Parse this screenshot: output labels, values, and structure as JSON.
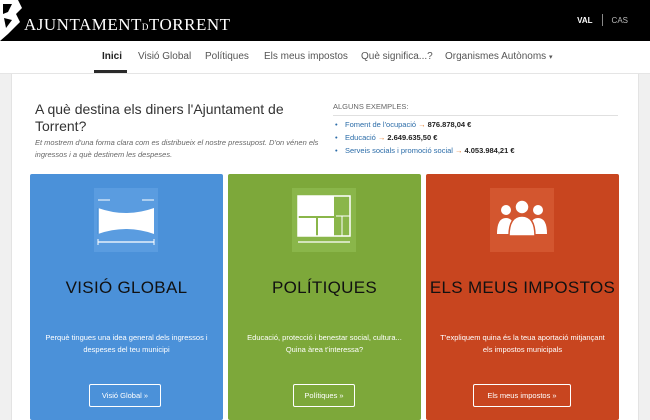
{
  "header": {
    "logo_text": "AJUNTAMENT",
    "logo_small": "D",
    "logo_text2": "TORRENT",
    "lang_active": "VAL",
    "lang_other": "CAS"
  },
  "nav": {
    "items": [
      "Inici",
      "Visió Global",
      "Polítiques",
      "Els meus impostos",
      "Què significa...?",
      "Organismes Autònoms"
    ],
    "caret": "▾"
  },
  "intro": {
    "title": "A què destina els diners l'Ajuntament de Torrent?",
    "subtitle": "Et mostrem d'una forma clara com es distribueix el nostre pressupost. D'on vénen els ingressos i a què destinem les despeses.",
    "examples_title": "ALGUNS EXEMPLES:",
    "examples": [
      {
        "label": "Foment de l'ocupació",
        "arrow": "→",
        "amount": "876.878,04 €"
      },
      {
        "label": "Educació",
        "arrow": "→",
        "amount": "2.649.635,50 €"
      },
      {
        "label": "Serveis socials i promoció social",
        "arrow": "→",
        "amount": "4.053.984,21 €"
      }
    ]
  },
  "cards": [
    {
      "title": "VISIÓ GLOBAL",
      "desc": "Perquè tingues una idea general dels ingressos i despeses del teu municipi",
      "button": "Visió Global »",
      "color": "#4b91d9",
      "icon": "flow-chart-icon"
    },
    {
      "title": "POLÍTIQUES",
      "desc": "Educació, protecció i benestar social, cultura... Quina àrea t'interessa?",
      "button": "Polítiques »",
      "color": "#7da83a",
      "icon": "treemap-icon"
    },
    {
      "title": "ELS MEUS IMPOSTOS",
      "desc": "T'expliquem quina és la teua aportació mitjançant els impostos municipals",
      "button": "Els meus impostos »",
      "color": "#c8451f",
      "icon": "people-group-icon"
    }
  ]
}
